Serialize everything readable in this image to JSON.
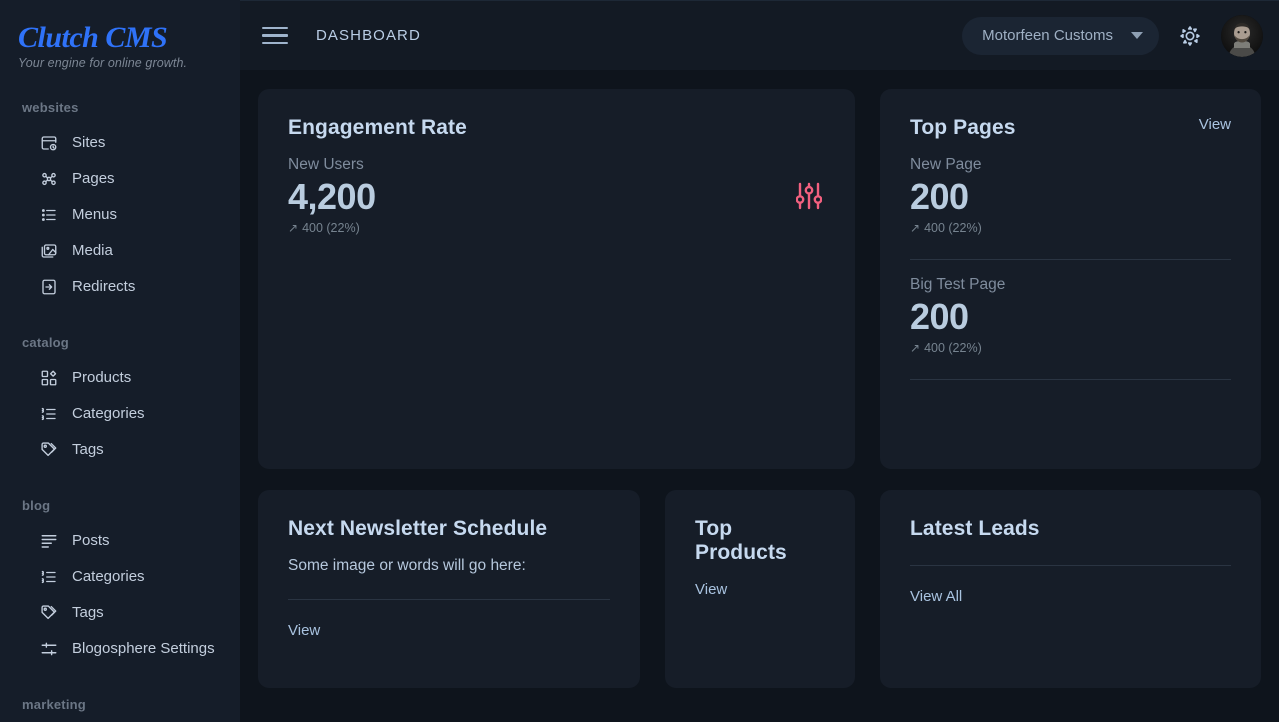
{
  "brand": {
    "title": "Clutch CMS",
    "tagline": "Your engine for online growth."
  },
  "colors": {
    "brand_blue": "#2f72f8",
    "page_bg": "#0e141c",
    "sidebar_bg": "#151d29",
    "card_bg": "#161d28",
    "accent_pink": "#f2607f",
    "text_primary": "#c6d9ef",
    "text_muted": "#7f8c9d"
  },
  "sidebar": {
    "sections": [
      {
        "label": "websites",
        "items": [
          {
            "label": "Sites",
            "icon": "sites-icon"
          },
          {
            "label": "Pages",
            "icon": "pages-icon"
          },
          {
            "label": "Menus",
            "icon": "menus-icon"
          },
          {
            "label": "Media",
            "icon": "media-icon"
          },
          {
            "label": "Redirects",
            "icon": "redirects-icon"
          }
        ]
      },
      {
        "label": "catalog",
        "items": [
          {
            "label": "Products",
            "icon": "products-icon"
          },
          {
            "label": "Categories",
            "icon": "categories-icon"
          },
          {
            "label": "Tags",
            "icon": "tags-icon"
          }
        ]
      },
      {
        "label": "blog",
        "items": [
          {
            "label": "Posts",
            "icon": "posts-icon"
          },
          {
            "label": "Categories",
            "icon": "categories-icon"
          },
          {
            "label": "Tags",
            "icon": "tags-icon"
          },
          {
            "label": "Blogosphere Settings",
            "icon": "settings-sliders-icon"
          }
        ]
      },
      {
        "label": "marketing",
        "items": []
      }
    ]
  },
  "topbar": {
    "menu_icon": "hamburger-icon",
    "title": "DASHBOARD",
    "site_selector": {
      "value": "Motorfeen Customs",
      "caret_icon": "chevron-down-icon"
    },
    "theme_toggle_icon": "sun-brightness-icon",
    "avatar_icon": "user-avatar"
  },
  "cards": {
    "engagement": {
      "title": "Engagement Rate",
      "icon": "sliders-icon",
      "metric": {
        "label": "New Users",
        "value": "4,200",
        "delta_arrow": "↗",
        "delta": "400 (22%)"
      }
    },
    "top_pages": {
      "title": "Top Pages",
      "view_label": "View",
      "entries": [
        {
          "label": "New Page",
          "value": "200",
          "delta_arrow": "↗",
          "delta": "400 (22%)"
        },
        {
          "label": "Big Test Page",
          "value": "200",
          "delta_arrow": "↗",
          "delta": "400 (22%)"
        }
      ]
    },
    "newsletter": {
      "title": "Next Newsletter Schedule",
      "body": "Some image or words will go here:",
      "view_label": "View"
    },
    "top_products": {
      "title": "Top Products",
      "view_label": "View"
    },
    "latest_leads": {
      "title": "Latest Leads",
      "view_all_label": "View All"
    }
  }
}
